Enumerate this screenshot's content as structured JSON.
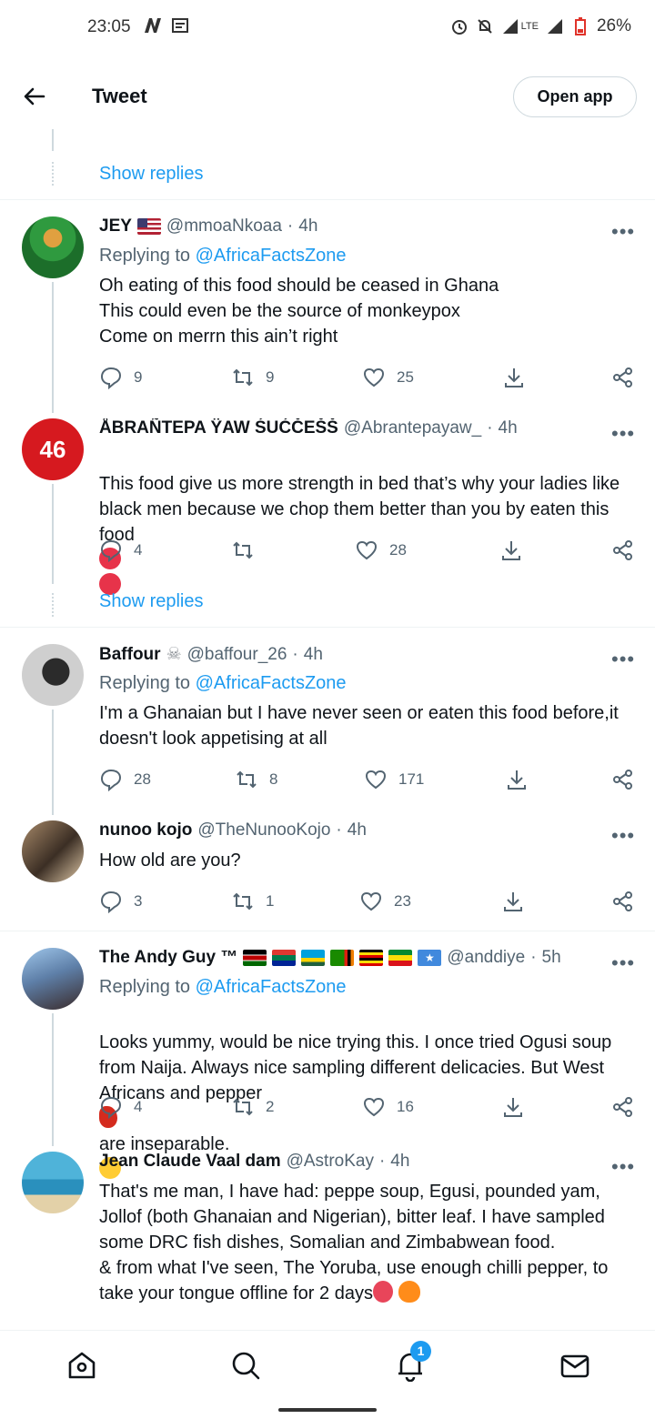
{
  "status_bar": {
    "time": "23:05",
    "network": "LTE",
    "battery": "26%"
  },
  "header": {
    "title": "Tweet",
    "open_app_label": "Open app"
  },
  "top_fragment": {
    "show_replies": "Show replies"
  },
  "tweets": [
    {
      "name": "JEY",
      "handle": "@mmoaNkoaa",
      "time": "4h",
      "replying_prefix": "Replying to",
      "replying_to": "@AfricaFactsZone",
      "text": "Oh eating of this  food should be ceased in Ghana\nThis could even be the source of monkeypox\nCome on merrn this ain’t right",
      "replies": "9",
      "retweets": "9",
      "likes": "25"
    },
    {
      "name": "ÅBRAÑTEPA ŸAW ŚUĆČEŠŠ",
      "handle": "@Abrantepayaw_",
      "time": "4h",
      "text": "This food give us more strength in bed that’s why your ladies like black men because we chop them better than you by eaten this food",
      "replies": "4",
      "retweets": "",
      "likes": "28",
      "show_replies": "Show replies"
    },
    {
      "name": "Baffour",
      "handle": "@baffour_26",
      "time": "4h",
      "replying_prefix": "Replying to",
      "replying_to": "@AfricaFactsZone",
      "text": "I'm a Ghanaian but I have never seen or eaten this food before,it doesn't look appetising at all",
      "replies": "28",
      "retweets": "8",
      "likes": "171"
    },
    {
      "name": "nunoo kojo",
      "handle": "@TheNunooKojo",
      "time": "4h",
      "text": "How old are you?",
      "replies": "3",
      "retweets": "1",
      "likes": "23"
    },
    {
      "name": "The Andy Guy ™",
      "handle": "@anddiye",
      "time": "5h",
      "replying_prefix": "Replying to",
      "replying_to": "@AfricaFactsZone",
      "text_a": "Looks yummy, would be nice trying this. I once tried Ogusi soup from Naija. Always nice sampling different delicacies. But West Africans and pepper",
      "text_b": "are inseparable.",
      "replies": "4",
      "retweets": "2",
      "likes": "16"
    },
    {
      "name": "Jean Claude Vaal dam",
      "handle": "@AstroKay",
      "time": "4h",
      "text": "That's me man, I have had: peppe soup, Egusi, pounded yam, Jollof (both Ghanaian and Nigerian), bitter leaf. I have sampled some DRC fish dishes, Somalian and Zimbabwean food.\n& from what I've seen, The Yoruba, use enough chilli pepper, to take your tongue offline for 2 days"
    }
  ],
  "bottom_nav": {
    "notification_count": "1"
  },
  "colors": {
    "accent": "#1d9bf0",
    "secondary_text": "#536471",
    "primary_text": "#0f1419",
    "divider": "#eff3f4"
  }
}
